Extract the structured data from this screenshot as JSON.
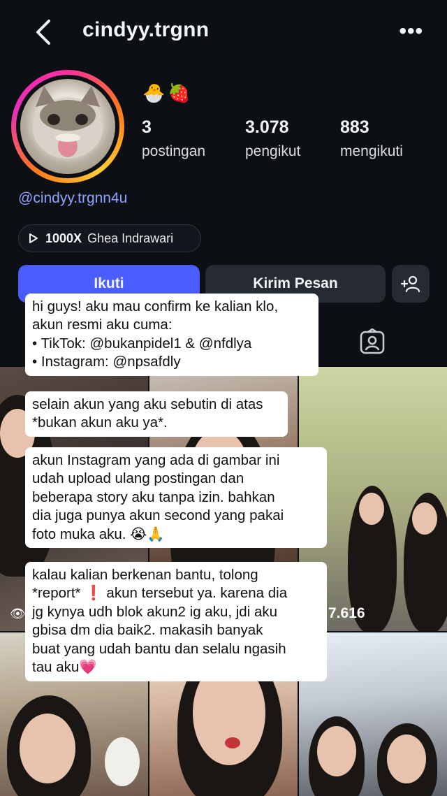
{
  "header": {
    "username": "cindyy.trgnn",
    "more_label": "•••"
  },
  "profile": {
    "emoji": "🐣🍓",
    "handle": "@cindyy.trgnn4u",
    "stats": [
      {
        "value": "3",
        "label": "postingan"
      },
      {
        "value": "3.078",
        "label": "pengikut"
      },
      {
        "value": "883",
        "label": "mengikuti"
      }
    ],
    "music": {
      "badge": "1000X",
      "artist": "Ghea Indrawari"
    }
  },
  "actions": {
    "follow_label": "Ikuti",
    "message_label": "Kirim Pesan"
  },
  "grid": {
    "view_count": "7.616"
  },
  "overlay_text": {
    "bubble1": [
      "hi guys! aku mau confirm ke kalian klo,",
      "akun resmi aku cuma:",
      "• TikTok: @bukanpidel1 & @nfdlya",
      "• Instagram: @npsafdly"
    ],
    "bubble2": [
      "selain akun yang aku sebutin di atas",
      "*bukan akun aku ya*."
    ],
    "bubble3": [
      "akun Instagram yang ada di gambar ini",
      "udah upload ulang postingan dan",
      "beberapa story aku tanpa izin. bahkan",
      "dia juga punya akun second yang pakai",
      "foto muka aku. 😭🙏"
    ],
    "bubble4": [
      "kalau kalian berkenan bantu, tolong",
      "*report* ❗ akun tersebut ya. karena dia",
      "jg kynya udh blok akun2 ig aku, jdi aku",
      "gbisa dm dia baik2. makasih banyak",
      "buat yang udah bantu dan selalu ngasih",
      "tau aku💗"
    ]
  },
  "colors": {
    "background": "#0c0f14",
    "follow_button": "#4a5dff",
    "secondary_button": "#262a33",
    "handle_link": "#8fa4ff"
  },
  "icons": [
    "back-arrow-icon",
    "more-icon",
    "play-icon",
    "add-person-icon",
    "tagged-tab-icon",
    "eye-icon"
  ]
}
